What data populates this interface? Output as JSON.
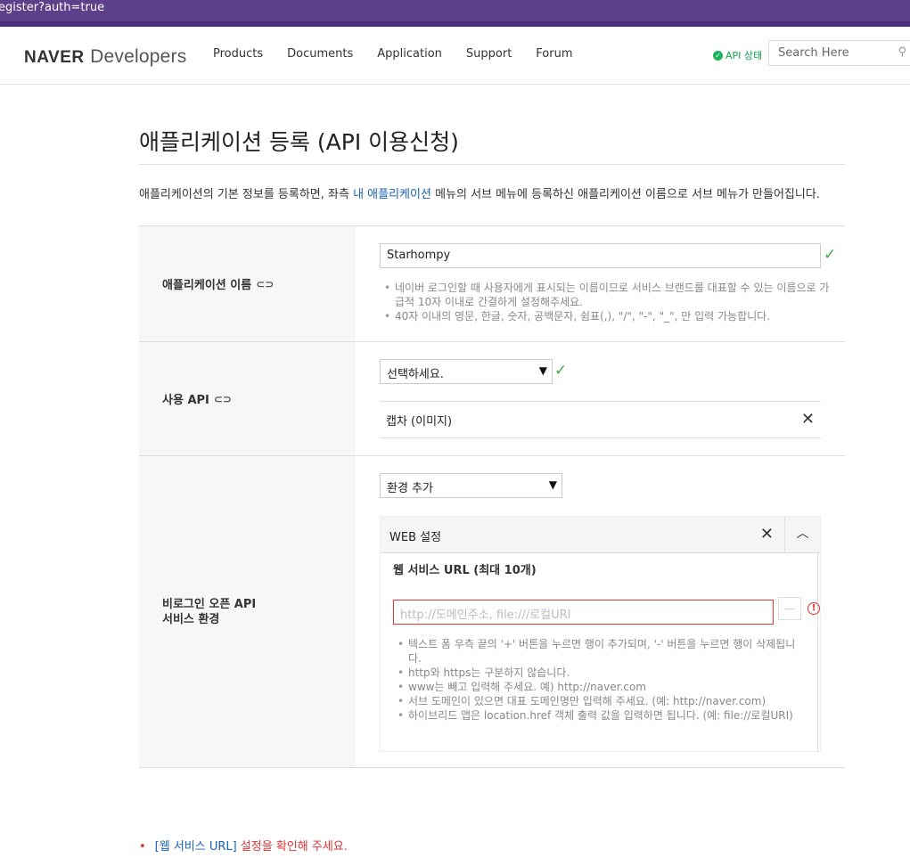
{
  "browser": {
    "url_text": "egister?auth=true"
  },
  "header": {
    "logo_bold": "NAVER",
    "logo_text": "Developers",
    "menu": [
      "Products",
      "Documents",
      "Application",
      "Support",
      "Forum"
    ],
    "api_status": "API 상태",
    "search_placeholder": "Search Here"
  },
  "page": {
    "title": "애플리케이션 등록 (API 이용신청)",
    "desc_before": "애플리케이션의 기본 정보를 등록하면, 좌측 ",
    "desc_link": "내 애플리케이션",
    "desc_after": " 메뉴의 서브 메뉴에 등록하신 애플리케이션 이름으로 서브 메뉴가 만들어집니다."
  },
  "form": {
    "app_name": {
      "label": "애플리케이션 이름",
      "value": "Starhompy",
      "notes": [
        "네이버 로그인할 때 사용자에게 표시되는 이름이므로 서비스 브랜드를 대표할 수 있는 이름으로 가급적 10자 이내로 간결하게 설정해주세요.",
        "40자 이내의 영문, 한글, 숫자, 공백문자, 쉼표(,), \"/\", \"-\", \"_\", 만 입력 가능합니다."
      ]
    },
    "use_api": {
      "label": "사용 API",
      "select_value": "선택하세요.",
      "selected_item": "캡차 (이미지)"
    },
    "env": {
      "label_line1": "비로그인 오픈 API",
      "label_line2": "서비스 환경",
      "select_value": "환경 추가",
      "panel_title": "WEB 설정",
      "url_label": "웹 서비스 URL (최대 10개)",
      "url_placeholder": "http://도메인주소, file:///로컬URI",
      "notes": [
        "텍스트 폼 우측 끝의 '+' 버튼을 누르면 행이 추가되며, '-' 버튼을 누르면 행이 삭제됩니다.",
        "http와 https는 구분하지 않습니다.",
        "www는 빼고 입력해 주세요. 예) http://naver.com",
        "서브 도메인이 있으면 대표 도메인명만 입력해 주세요. (예: http://naver.com)",
        "하이브리드 앱은 location.href 객체 출력 값을 입력하면 됩니다. (예: file://로컬URI)"
      ]
    }
  },
  "error": {
    "link": "[웹 서비스 URL]",
    "text": " 설정을 확인해 주세요."
  }
}
